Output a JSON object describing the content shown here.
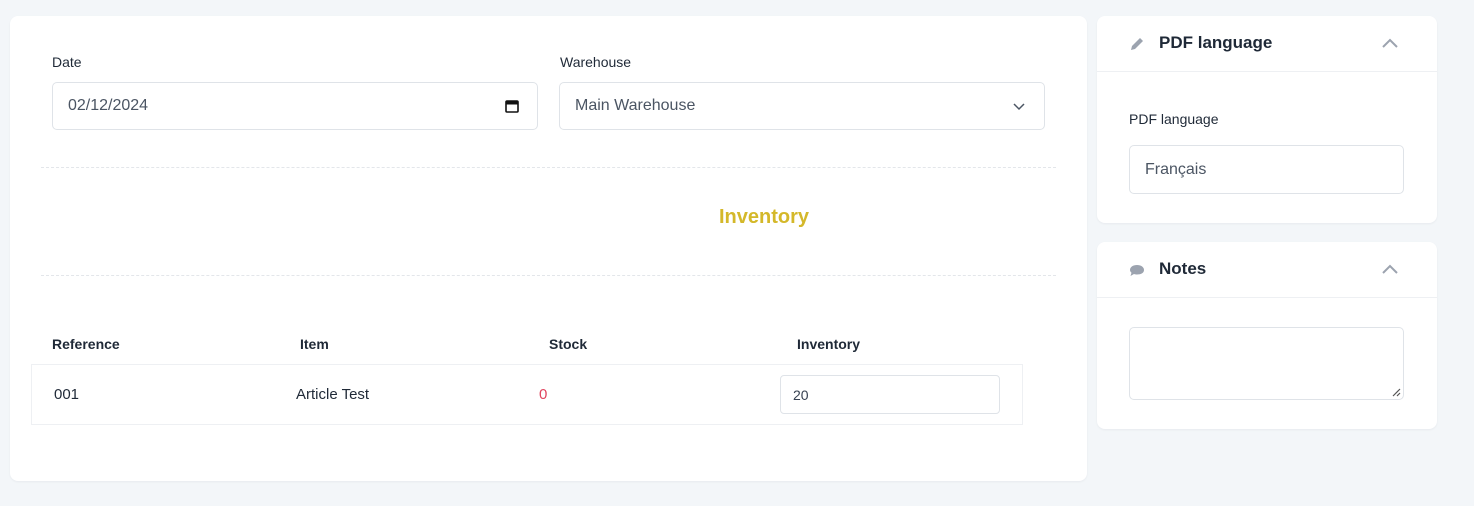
{
  "form": {
    "date_label": "Date",
    "date_value": "02/12/2024",
    "warehouse_label": "Warehouse",
    "warehouse_value": "Main Warehouse"
  },
  "section": {
    "title": "Inventory"
  },
  "table": {
    "headers": [
      "Reference",
      "Item",
      "Stock",
      "Inventory"
    ],
    "rows": [
      {
        "reference": "001",
        "item": "Article Test",
        "stock": "0",
        "inventory": "20"
      }
    ]
  },
  "pdf_panel": {
    "title": "PDF language",
    "field_label": "PDF language",
    "value": "Français"
  },
  "notes_panel": {
    "title": "Notes",
    "value": ""
  },
  "icons": {
    "date": "calendar-icon",
    "warehouse": "chevron-down-icon",
    "pdf": "pencil-icon",
    "notes": "chat-bubble-icon",
    "collapse": "chevron-up-icon",
    "resize": "resize-handle-icon"
  },
  "colors": {
    "section_title": "#d4b82a",
    "stock_zero": "#e0455f",
    "background": "#f3f6f9"
  }
}
